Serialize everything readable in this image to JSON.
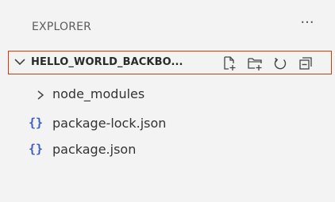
{
  "explorer": {
    "title": "EXPLORER",
    "more_label": "···"
  },
  "workspace": {
    "folder_name": "HELLO_WORLD_BACKBO...",
    "actions": [
      "new-file",
      "new-folder",
      "refresh",
      "collapse-all"
    ]
  },
  "tree": [
    {
      "type": "folder",
      "label": "node_modules",
      "icon": "chevron-right-icon"
    },
    {
      "type": "file",
      "label": "package-lock.json",
      "icon": "json-icon",
      "icon_glyph": "{}"
    },
    {
      "type": "file",
      "label": "package.json",
      "icon": "json-icon",
      "icon_glyph": "{}"
    }
  ],
  "colors": {
    "background": "#f3f3f3",
    "focus_border": "#d83b01",
    "json_icon": "#3d5ec2"
  }
}
